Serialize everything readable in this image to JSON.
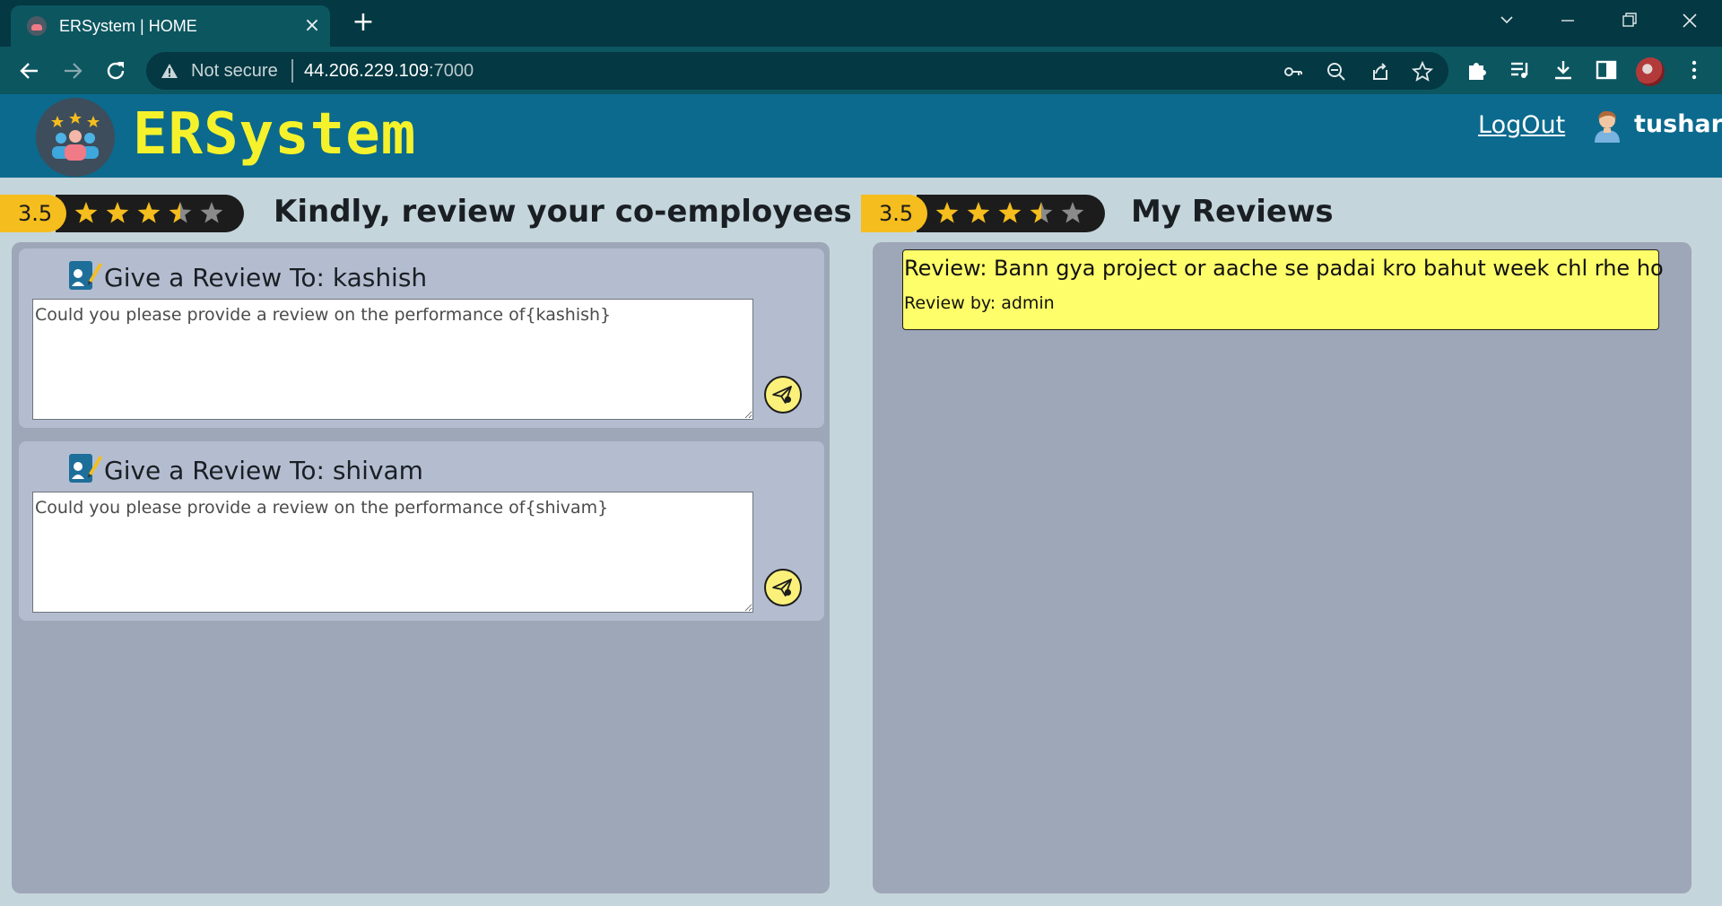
{
  "browser": {
    "tab_title": "ERSystem | HOME",
    "security_label": "Not secure",
    "url_host": "44.206.229.109",
    "url_port": ":7000"
  },
  "app": {
    "brand": "ERSystem",
    "logout_label": "LogOut",
    "username": "tushar"
  },
  "left": {
    "rating_value": "3.5",
    "rating_stars": 3.5,
    "rating_max": 5,
    "title": "Kindly, review your co-employees",
    "cards": [
      {
        "title": "Give a Review To: kashish",
        "placeholder": "Could you please provide a review on the performance of{kashish}"
      },
      {
        "title": "Give a Review To: shivam",
        "placeholder": "Could you please provide a review on the performance of{shivam}"
      }
    ]
  },
  "right": {
    "rating_value": "3.5",
    "rating_stars": 3.5,
    "rating_max": 5,
    "title": "My Reviews",
    "reviews": [
      {
        "text": "Review: Bann gya project or aache se padai kro bahut week chl rhe ho",
        "by": "Review by: admin"
      }
    ]
  },
  "colors": {
    "star_fill": "#f5bd1d",
    "star_empty": "#8a8a8a",
    "brand": "#f5f22c",
    "header_bg": "#0b6a8e"
  }
}
